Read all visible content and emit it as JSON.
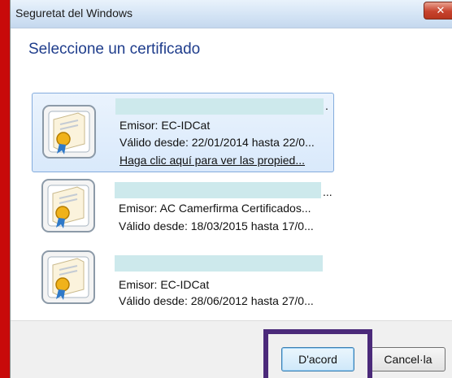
{
  "window": {
    "title": "Seguretat del Windows",
    "close_label": "✕"
  },
  "heading": "Seleccione un certificado",
  "certificates": [
    {
      "name_suffix": ".",
      "issuer": "Emisor: EC-IDCat",
      "validity": "Válido desde: 22/01/2014 hasta 22/0...",
      "link": "Haga clic aquí para ver las propied...",
      "selected": true
    },
    {
      "name_suffix": "...",
      "issuer": "Emisor: AC Camerfirma Certificados...",
      "validity": "Válido desde: 18/03/2015 hasta 17/0...",
      "selected": false
    },
    {
      "name_suffix": "",
      "issuer": "Emisor: EC-IDCat",
      "validity": "Válido desde: 28/06/2012 hasta 27/0...",
      "selected": false
    }
  ],
  "buttons": {
    "ok": "D'acord",
    "cancel": "Cancel·la"
  },
  "colors": {
    "accent": "#1f3d8c",
    "highlight": "#4b2a7a",
    "background": "#c40000"
  }
}
